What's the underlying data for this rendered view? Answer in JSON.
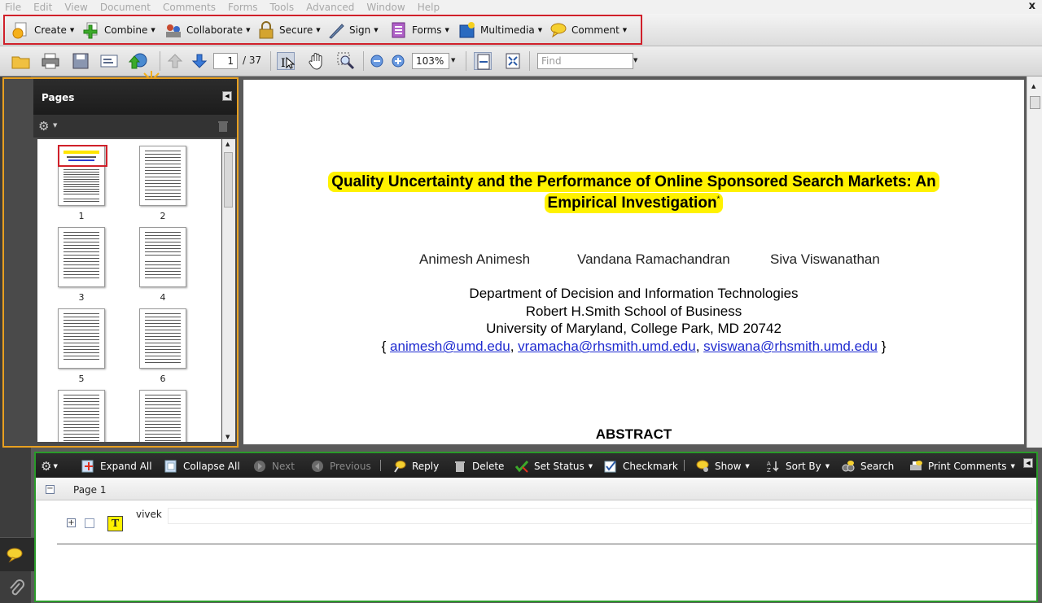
{
  "menu": [
    "File",
    "Edit",
    "View",
    "Document",
    "Comments",
    "Forms",
    "Tools",
    "Advanced",
    "Window",
    "Help"
  ],
  "window_close": "x",
  "tasks": [
    {
      "label": "Create",
      "icon": "create-icon"
    },
    {
      "label": "Combine",
      "icon": "combine-icon"
    },
    {
      "label": "Collaborate",
      "icon": "collaborate-icon"
    },
    {
      "label": "Secure",
      "icon": "lock-icon"
    },
    {
      "label": "Sign",
      "icon": "pen-icon"
    },
    {
      "label": "Forms",
      "icon": "forms-icon"
    },
    {
      "label": "Multimedia",
      "icon": "multimedia-icon"
    },
    {
      "label": "Comment",
      "icon": "comment-bubble-icon"
    }
  ],
  "toolbar": {
    "page_current": "1",
    "page_total": "/ 37",
    "zoom": "103%",
    "find_placeholder": "Find"
  },
  "pages_panel": {
    "title": "Pages",
    "thumbs": [
      "1",
      "2",
      "3",
      "4",
      "5",
      "6"
    ]
  },
  "document": {
    "title_line1": "Quality Uncertainty and the Performance of Online Sponsored Search Markets: An",
    "title_line2": "Empirical Investigation",
    "title_mark": "*",
    "authors": [
      "Animesh Animesh",
      "Vandana Ramachandran",
      "Siva Viswanathan"
    ],
    "affiliation": [
      "Department of Decision and Information Technologies",
      "Robert H.Smith School of Business",
      "University of Maryland, College Park, MD 20742"
    ],
    "emails": [
      "animesh@umd.edu",
      "vramacha@rhsmith.umd.edu",
      "sviswana@rhsmith.umd.edu"
    ],
    "brace_open": "{",
    "comma": ",",
    "brace_close": "}",
    "abstract_heading": "ABSTRACT"
  },
  "comments_panel": {
    "buttons": [
      {
        "label": "Expand All",
        "enabled": true
      },
      {
        "label": "Collapse All",
        "enabled": true
      },
      {
        "label": "Next",
        "enabled": false
      },
      {
        "label": "Previous",
        "enabled": false
      },
      {
        "label": "Reply",
        "enabled": true
      },
      {
        "label": "Delete",
        "enabled": true
      },
      {
        "label": "Set Status",
        "enabled": true
      },
      {
        "label": "Checkmark",
        "enabled": true
      },
      {
        "label": "Show",
        "enabled": true
      },
      {
        "label": "Sort By",
        "enabled": true
      },
      {
        "label": "Search",
        "enabled": true
      },
      {
        "label": "Print Comments",
        "enabled": true
      }
    ],
    "page_group": "Page 1",
    "comment_author": "vivek"
  },
  "colors": {
    "task_highlight": "#d0202a",
    "pages_highlight": "#e8a020",
    "comments_highlight": "#2a9a2a",
    "title_highlight": "#fff200",
    "link": "#1f2bd0"
  }
}
